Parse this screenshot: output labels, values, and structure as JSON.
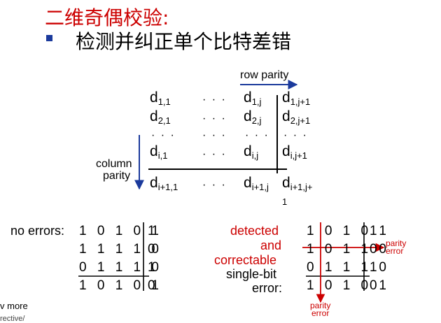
{
  "title": "二维奇偶校验:",
  "bullet": "检测并纠正单个比特差错",
  "matrix": {
    "row_parity_label": "row parity",
    "column_parity_label_1": "column",
    "column_parity_label_2": "parity",
    "dots": "· · ·",
    "cells": {
      "r1c1": "d",
      "r1c1_sub": "1,1",
      "r1cj": "d",
      "r1cj_sub": "1,j",
      "r1cj1": "d",
      "r1cj1_sub": "1,j+1",
      "r2c1": "d",
      "r2c1_sub": "2,1",
      "r2cj": "d",
      "r2cj_sub": "2,j",
      "r2cj1": "d",
      "r2cj1_sub": "2,j+1",
      "ric1": "d",
      "ric1_sub": "i,1",
      "ricj": "d",
      "ricj_sub": "i,j",
      "ricj1": "d",
      "ricj1_sub": "i,j+1",
      "rlc1": "d",
      "rlc1_sub": "i+1,1",
      "rlcj": "d",
      "rlcj_sub": "i+1,j",
      "rlcj1": "d",
      "rlcj1_sub": "i+1,j+",
      "rlcj1_wrap": "1"
    }
  },
  "no_errors": {
    "label": "no errors:",
    "rows": [
      {
        "data": "1 0 1 0 1",
        "parity": "1"
      },
      {
        "data": "1 1 1 1 0",
        "parity": "0"
      },
      {
        "data": "0 1 1 1 0",
        "parity": "1"
      },
      {
        "data": "1 0 1 0 1",
        "parity": "0"
      }
    ]
  },
  "error_case": {
    "label_red_1": "detected",
    "label_red_2": "and",
    "label_red_3": "correctable",
    "label_black_1": "single-bit",
    "label_black_2": "error:",
    "rows": [
      {
        "data": "1 0 1 0 1",
        "parity": "1"
      },
      {
        "data": "1 0 1 1 0",
        "parity": "0"
      },
      {
        "data": "0 1 1 1 0",
        "parity": "1"
      },
      {
        "data": "1 0 1 0 1",
        "parity": "0"
      }
    ],
    "parity_error_right_1": "parity",
    "parity_error_right_2": "error",
    "parity_error_bottom_1": "parity",
    "parity_error_bottom_2": "error"
  },
  "footer": {
    "line1": "v more",
    "line2": "rective/"
  },
  "colors": {
    "title": "#cc0000",
    "accent_blue": "#1b3a9c",
    "error_red": "#cc0000"
  }
}
